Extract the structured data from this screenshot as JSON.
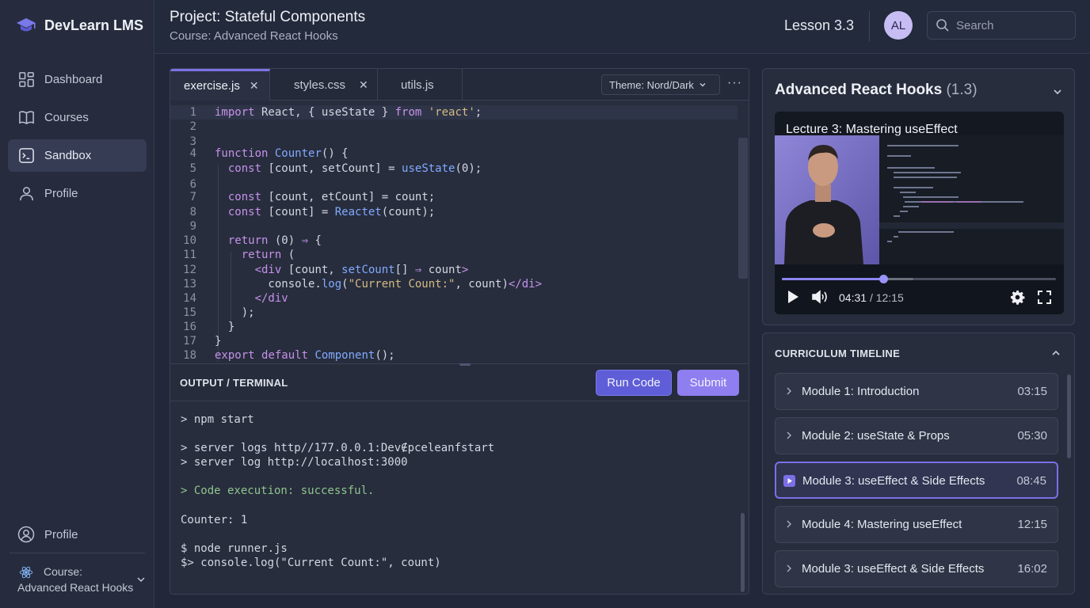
{
  "app": {
    "name": "DevLearn LMS"
  },
  "sidebar": {
    "items": [
      {
        "label": "Dashboard",
        "icon": "grid-icon",
        "active": false
      },
      {
        "label": "Courses",
        "icon": "book-icon",
        "active": false
      },
      {
        "label": "Sandbox",
        "icon": "terminal-icon",
        "active": true
      },
      {
        "label": "Profile",
        "icon": "user-icon",
        "active": false
      }
    ],
    "bottom_profile": "Profile",
    "course_switch": {
      "label": "Course:",
      "name": "Advanced React Hooks"
    }
  },
  "header": {
    "project_title": "Project: Stateful Components",
    "course_subtitle": "Course: Advanced React Hooks",
    "lesson": "Lesson 3.3",
    "avatar_initials": "AL",
    "search_placeholder": "Search"
  },
  "editor": {
    "tabs": [
      {
        "label": "exercise.js",
        "closable": true,
        "active": true
      },
      {
        "label": "styles.css",
        "closable": true,
        "active": false
      },
      {
        "label": "utils.js",
        "closable": false,
        "active": false
      }
    ],
    "close_glyph": "✕",
    "theme_select": "Theme: Nord/Dark",
    "more_glyph": "···",
    "line_numbers": [
      "1",
      "2",
      "3",
      "4",
      "5",
      "6",
      "7",
      "8",
      "9",
      "10",
      "11",
      "12",
      "13",
      "14",
      "15",
      "16",
      "17",
      "18"
    ],
    "output_title": "OUTPUT / TERMINAL",
    "run_label": "Run Code",
    "submit_label": "Submit"
  },
  "terminal": {
    "lines": [
      "> npm start",
      "> server logs http//177.0.0.1:Dev∉pceleanfstart",
      "> server log http://localhost:3000",
      "> Code execution: successful.",
      "Counter: 1",
      "$ node runner.js",
      "$> console.log(\"Current Count:\", count)"
    ]
  },
  "video": {
    "panel_title": "Advanced React Hooks",
    "panel_count": "(1.3)",
    "caption": "Lecture 3: Mastering useEffect",
    "current_time": "04:31",
    "total_time": "/ 12:15",
    "progress": 0.37,
    "buffered": 0.48
  },
  "curriculum": {
    "title": "CURRICULUM TIMELINE",
    "modules": [
      {
        "label": "Module 1: Introduction",
        "time": "03:15",
        "active": false
      },
      {
        "label": "Module 2: useState & Props",
        "time": "05:30",
        "active": false
      },
      {
        "label": "Module 3: useEffect & Side Effects",
        "time": "08:45",
        "active": true
      },
      {
        "label": "Module 4: Mastering useEffect",
        "time": "12:15",
        "active": false
      },
      {
        "label": "Module 3: useEffect & Side Effects",
        "time": "16:02",
        "active": false
      }
    ]
  },
  "colors": {
    "accent": "#7c6fe6",
    "run_button": "#5f5ed8",
    "submit_button": "#8e7ef0",
    "success_text": "#8fc48c",
    "background": "#222839"
  }
}
